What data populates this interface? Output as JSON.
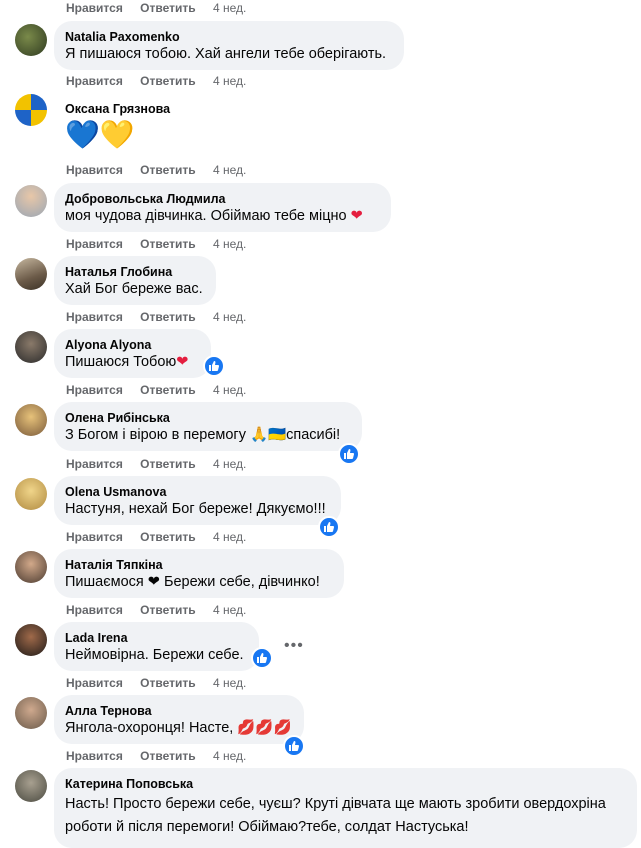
{
  "top_actions": {
    "like": "Нравится",
    "reply": "Ответить",
    "time": "4 нед."
  },
  "comments": [
    {
      "author": "Natalia Paxomenko",
      "text": "Я пишаюся тобою. Хай ангели тебе оберігають.",
      "like": "Нравится",
      "reply": "Ответить",
      "time": "4 нед."
    },
    {
      "author": "Оксана Грязнова",
      "text": "💙💛",
      "like": "Нравится",
      "reply": "Ответить",
      "time": "4 нед."
    },
    {
      "author": "Добровольська Людмила",
      "text": "моя чудова дівчинка. Обіймаю тебе міцно",
      "like": "Нравится",
      "reply": "Ответить",
      "time": "4 нед."
    },
    {
      "author": "Наталья Глобина",
      "text": "Хай Бог береже вас.",
      "like": "Нравится",
      "reply": "Ответить",
      "time": "4 нед."
    },
    {
      "author": "Alyona Alyona",
      "text": "Пишаюся Тобою",
      "like": "Нравится",
      "reply": "Ответить",
      "time": "4 нед."
    },
    {
      "author": "Олена Рибінська",
      "text": "З Богом і вірою в перемогу 🙏🇺🇦спасибі!",
      "like": "Нравится",
      "reply": "Ответить",
      "time": "4 нед."
    },
    {
      "author": "Olena Usmanova",
      "text": "Настуня, нехай Бог береже! Дякуємо!!!",
      "like": "Нравится",
      "reply": "Ответить",
      "time": "4 нед."
    },
    {
      "author": "Наталія Тяпкіна",
      "text": "Пишаємося ❤ Бережи себе, дівчинко!",
      "like": "Нравится",
      "reply": "Ответить",
      "time": "4 нед."
    },
    {
      "author": "Lada Irena",
      "text": "Неймовірна. Бережи себе.",
      "like": "Нравится",
      "reply": "Ответить",
      "time": "4 нед."
    },
    {
      "author": "Алла Тернова",
      "text": "Янгола-охоронця! Насте, 💋💋💋",
      "like": "Нравится",
      "reply": "Ответить",
      "time": "4 нед."
    },
    {
      "author": "Катерина Поповська",
      "text_line1": "Насть! Просто бережи себе, чуєш? Круті дівчата ще мають зробити овердохріна",
      "text_line2": "роботи й після перемоги! Обіймаю?тебе, солдат Настуська!"
    }
  ],
  "more_options": "•••",
  "colors": {
    "bubble": "#f0f2f5",
    "meta": "#65676b",
    "like_blue": "#1877f2",
    "heart": "#e41e3f"
  }
}
